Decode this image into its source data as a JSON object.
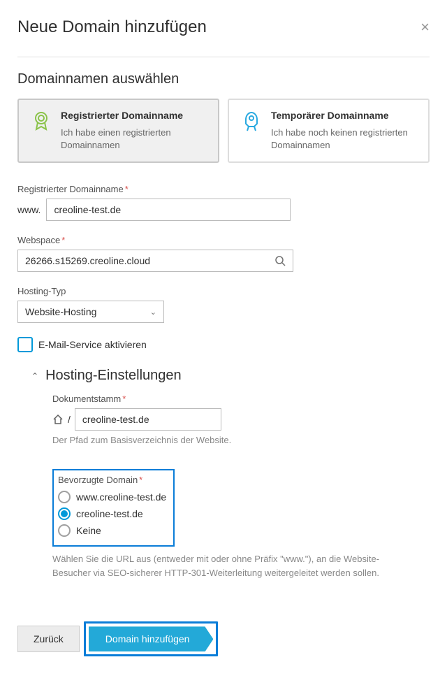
{
  "dialog": {
    "title": "Neue Domain hinzufügen"
  },
  "section": {
    "select_domain": "Domainnamen auswählen"
  },
  "cards": {
    "registered": {
      "title": "Registrierter Domainname",
      "desc": "Ich habe einen registrierten Domainnamen"
    },
    "temporary": {
      "title": "Temporärer Domainname",
      "desc": "Ich habe noch keinen registrierten Domainnamen"
    }
  },
  "fields": {
    "domain_label": "Registrierter Domainname",
    "domain_prefix": "www.",
    "domain_value": "creoline-test.de",
    "webspace_label": "Webspace",
    "webspace_value": "26266.s15269.creoline.cloud",
    "hosting_type_label": "Hosting-Typ",
    "hosting_type_value": "Website-Hosting",
    "email_checkbox_label": "E-Mail-Service aktivieren"
  },
  "hosting": {
    "title": "Hosting-Einstellungen",
    "doc_root_label": "Dokumentstamm",
    "doc_root_prefix": "/",
    "doc_root_value": "creoline-test.de",
    "doc_root_hint": "Der Pfad zum Basisverzeichnis der Website.",
    "pref_domain_label": "Bevorzugte Domain",
    "pref_option_www": "www.creoline-test.de",
    "pref_option_plain": "creoline-test.de",
    "pref_option_none": "Keine",
    "pref_hint": "Wählen Sie die URL aus (entweder mit oder ohne Präfix \"www.\"), an die Website-Besucher via SEO-sicherer HTTP-301-Weiterleitung weitergeleitet werden sollen."
  },
  "footer": {
    "back": "Zurück",
    "submit": "Domain hinzufügen"
  }
}
